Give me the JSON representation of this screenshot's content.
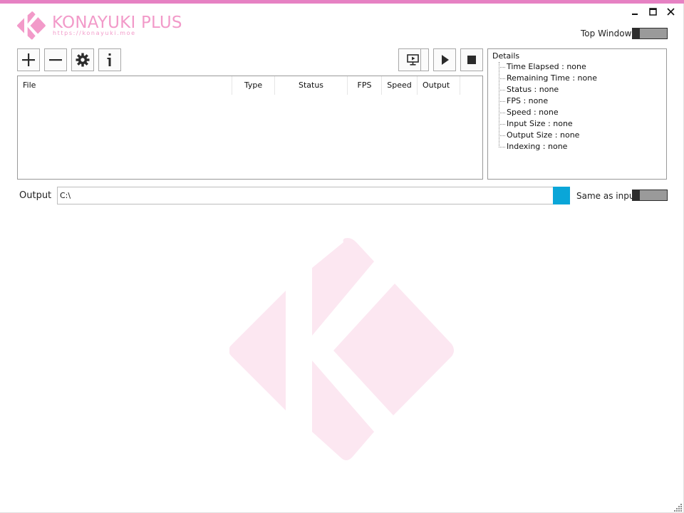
{
  "app": {
    "name": "KONAYUKI PLUS",
    "url": "https://konayuki.moe",
    "brand_color": "#f29ac9",
    "accent_bar_color": "#e681c3",
    "logo_icon": "konayuki-k-logo-icon"
  },
  "window_controls": {
    "minimize_icon": "minimize-icon",
    "maximize_icon": "maximize-icon",
    "close_icon": "close-icon"
  },
  "top_window": {
    "label": "Top Window",
    "enabled": false
  },
  "toolbar": {
    "left_icons": [
      "plus-icon",
      "minus-icon",
      "gear-icon",
      "info-icon"
    ],
    "right_icons": [
      "monitor-preview-icon",
      "play-icon",
      "stop-icon"
    ]
  },
  "file_list": {
    "columns": [
      "File",
      "Type",
      "Status",
      "FPS",
      "Speed",
      "Output"
    ],
    "rows": []
  },
  "details": {
    "title": "Details",
    "items": [
      "Time Elapsed : none",
      "Remaining Time : none",
      "Status : none",
      "FPS : none",
      "Speed : none",
      "Input Size : none",
      "Output Size : none",
      "Indexing : none"
    ]
  },
  "output": {
    "label": "Output",
    "value": "C:\\",
    "browse_color": "#0aa6d8"
  },
  "same_as_input": {
    "label": "Same as input",
    "enabled": false
  }
}
